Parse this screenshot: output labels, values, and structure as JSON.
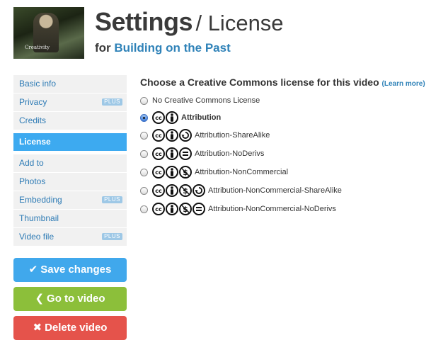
{
  "header": {
    "thumbnail_caption": "Creativity",
    "title": "Settings",
    "title_separator": "/ License",
    "subtitle_prefix": "for",
    "video_name": "Building on the Past"
  },
  "sidebar": {
    "items": [
      {
        "label": "Basic info",
        "plus": "",
        "active": false
      },
      {
        "label": "Privacy",
        "plus": "PLUS",
        "active": false
      },
      {
        "label": "Credits",
        "plus": "",
        "active": false
      },
      {
        "label": "License",
        "plus": "",
        "active": true
      },
      {
        "label": "Add to",
        "plus": "",
        "active": false
      },
      {
        "label": "Photos",
        "plus": "",
        "active": false
      },
      {
        "label": "Embedding",
        "plus": "PLUS",
        "active": false
      },
      {
        "label": "Thumbnail",
        "plus": "",
        "active": false
      },
      {
        "label": "Video file",
        "plus": "PLUS",
        "active": false
      }
    ],
    "buttons": {
      "save": "Save changes",
      "go": "Go to video",
      "delete": "Delete video"
    }
  },
  "main": {
    "heading": "Choose a Creative Commons license for this video",
    "learn_open": "(",
    "learn_more": "Learn more",
    "learn_close": ")",
    "options": [
      {
        "label": "No Creative Commons License",
        "icons": [],
        "checked": false
      },
      {
        "label": "Attribution",
        "icons": [
          "cc-icon",
          "by-icon"
        ],
        "checked": true
      },
      {
        "label": "Attribution-ShareAlike",
        "icons": [
          "cc-icon",
          "by-icon",
          "sa-icon"
        ],
        "checked": false
      },
      {
        "label": "Attribution-NoDerivs",
        "icons": [
          "cc-icon",
          "by-icon",
          "nd-icon"
        ],
        "checked": false
      },
      {
        "label": "Attribution-NonCommercial",
        "icons": [
          "cc-icon",
          "by-icon",
          "nc-icon"
        ],
        "checked": false
      },
      {
        "label": "Attribution-NonCommercial-ShareAlike",
        "icons": [
          "cc-icon",
          "by-icon",
          "nc-icon",
          "sa-icon"
        ],
        "checked": false
      },
      {
        "label": "Attribution-NonCommercial-NoDerivs",
        "icons": [
          "cc-icon",
          "by-icon",
          "nc-icon",
          "nd-icon"
        ],
        "checked": false
      }
    ]
  },
  "colors": {
    "accent_blue": "#3daaf0",
    "link_blue": "#2f82b8",
    "save_button": "#40a8ec",
    "go_button": "#8cbf3a",
    "delete_button": "#e5534b"
  }
}
